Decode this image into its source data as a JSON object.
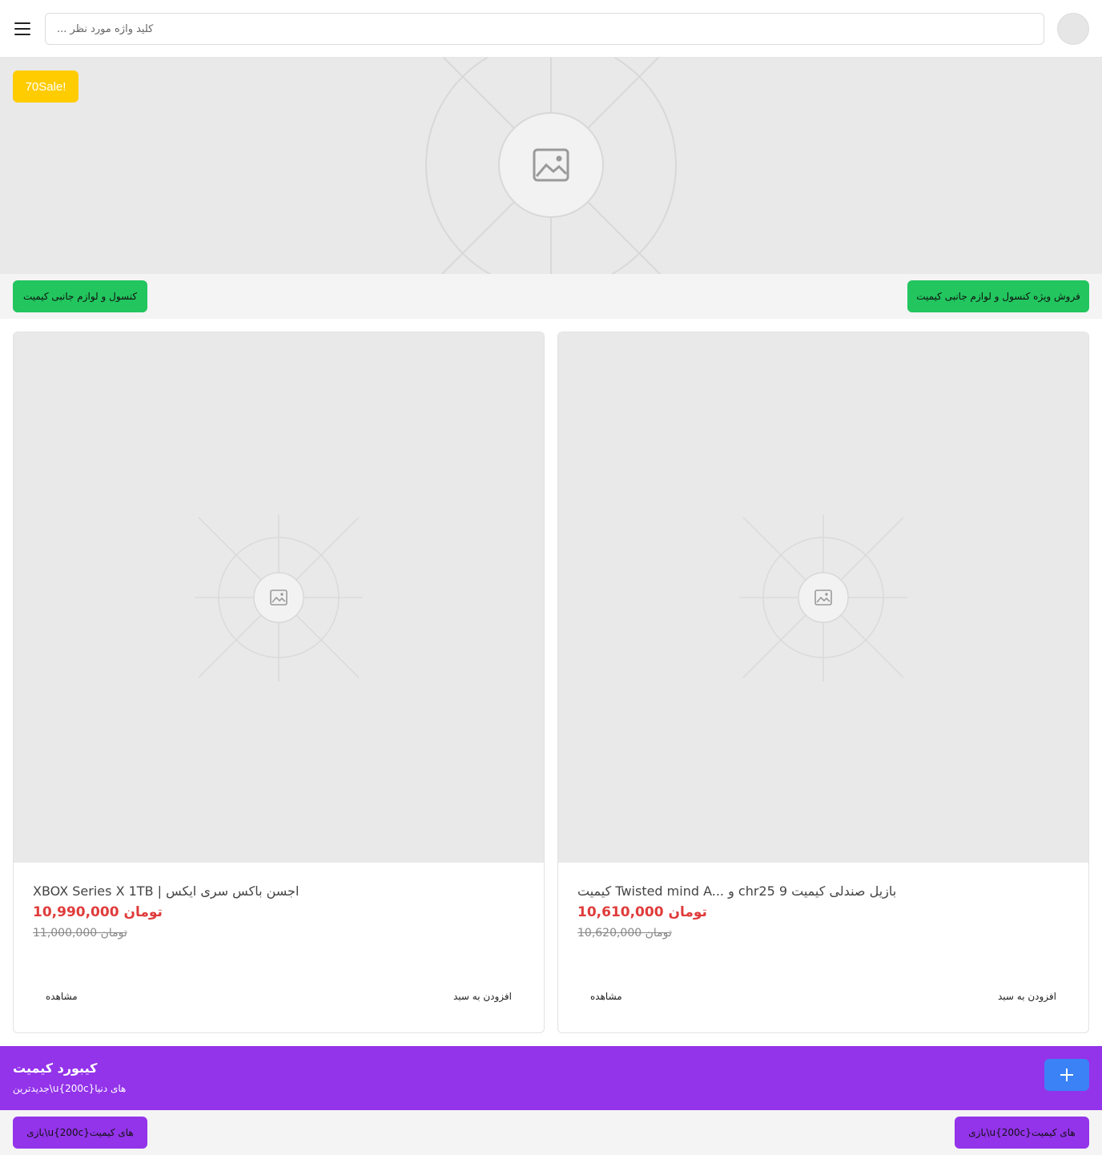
{
  "header": {
    "search_placeholder": "... کلید واژه مورد نظر"
  },
  "hero": {
    "sale_badge": "70Sale!"
  },
  "action_bar": {
    "left_button": "کنسول و لوازم جانبی کیمیت",
    "right_button": "فروش ویژه کنسول و لوازم جانبی کیمیت"
  },
  "products": [
    {
      "title": "XBOX Series X 1TB | اجسن باکس سری ایکس",
      "price": "10,990,000 تومان",
      "old_price": "11,000,000 تومان",
      "view_label": "مشاهده",
      "cart_label": "افزودن به سبد"
    },
    {
      "title": "کیمیت Twisted mind A... و chr25 9 بازیل صندلی کیمیت",
      "price": "10,610,000 تومان",
      "old_price": "10,620,000 تومان",
      "view_label": "مشاهده",
      "cart_label": "افزودن به سبد"
    }
  ],
  "banner": {
    "title": "کیبورد کیمیت",
    "subtitle": "جدیدترین\\u{200c}های دنیا"
  },
  "bottom_bar": {
    "left_button": "بازی\\u{200c}های کیمیت",
    "right_button": "بازی\\u{200c}های کیمیت"
  },
  "colors": {
    "accent_yellow": "#ffcc00",
    "accent_green": "#22c55e",
    "accent_purple": "#9333ea",
    "accent_blue": "#3b82f6",
    "price_red": "#e03b3b"
  },
  "icons": {
    "menu": "hamburger-icon",
    "image_placeholder": "image-icon",
    "plus": "plus-icon"
  }
}
